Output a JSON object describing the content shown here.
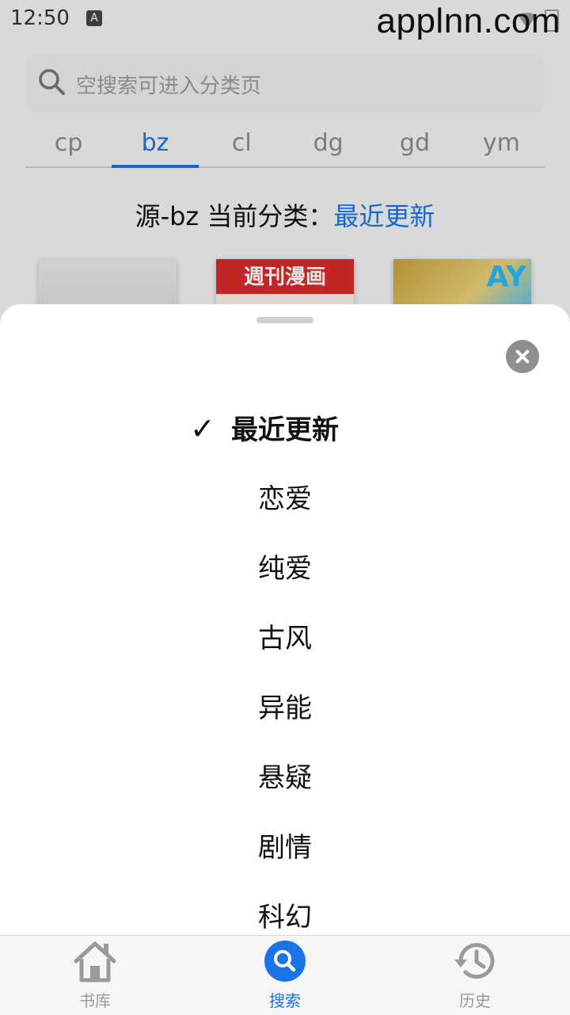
{
  "status_bar": {
    "time": "12:50",
    "indicator": "A"
  },
  "watermark": "applnn.com",
  "search": {
    "placeholder": "空搜索可进入分类页",
    "icon": "search-icon"
  },
  "tabs": [
    {
      "label": "cp",
      "active": false
    },
    {
      "label": "bz",
      "active": true
    },
    {
      "label": "cl",
      "active": false
    },
    {
      "label": "dg",
      "active": false
    },
    {
      "label": "gd",
      "active": false
    },
    {
      "label": "ym",
      "active": false
    }
  ],
  "category_line": {
    "prefix": "源-bz 当前分类：",
    "current": "最近更新"
  },
  "covers": {
    "cover2_text": "週刊漫画",
    "cover3_text": "AY"
  },
  "sheet": {
    "check_mark": "✓",
    "options": [
      {
        "label": "最近更新",
        "selected": true
      },
      {
        "label": "恋爱",
        "selected": false
      },
      {
        "label": "纯爱",
        "selected": false
      },
      {
        "label": "古风",
        "selected": false
      },
      {
        "label": "异能",
        "selected": false
      },
      {
        "label": "悬疑",
        "selected": false
      },
      {
        "label": "剧情",
        "selected": false
      },
      {
        "label": "科幻",
        "selected": false
      }
    ]
  },
  "bottom_nav": [
    {
      "label": "书库",
      "icon": "home-icon",
      "active": false
    },
    {
      "label": "搜索",
      "icon": "search-icon",
      "active": true
    },
    {
      "label": "历史",
      "icon": "history-icon",
      "active": false
    }
  ],
  "colors": {
    "accent": "#1a73e8",
    "text": "#111111",
    "muted": "#9a9a9a"
  }
}
